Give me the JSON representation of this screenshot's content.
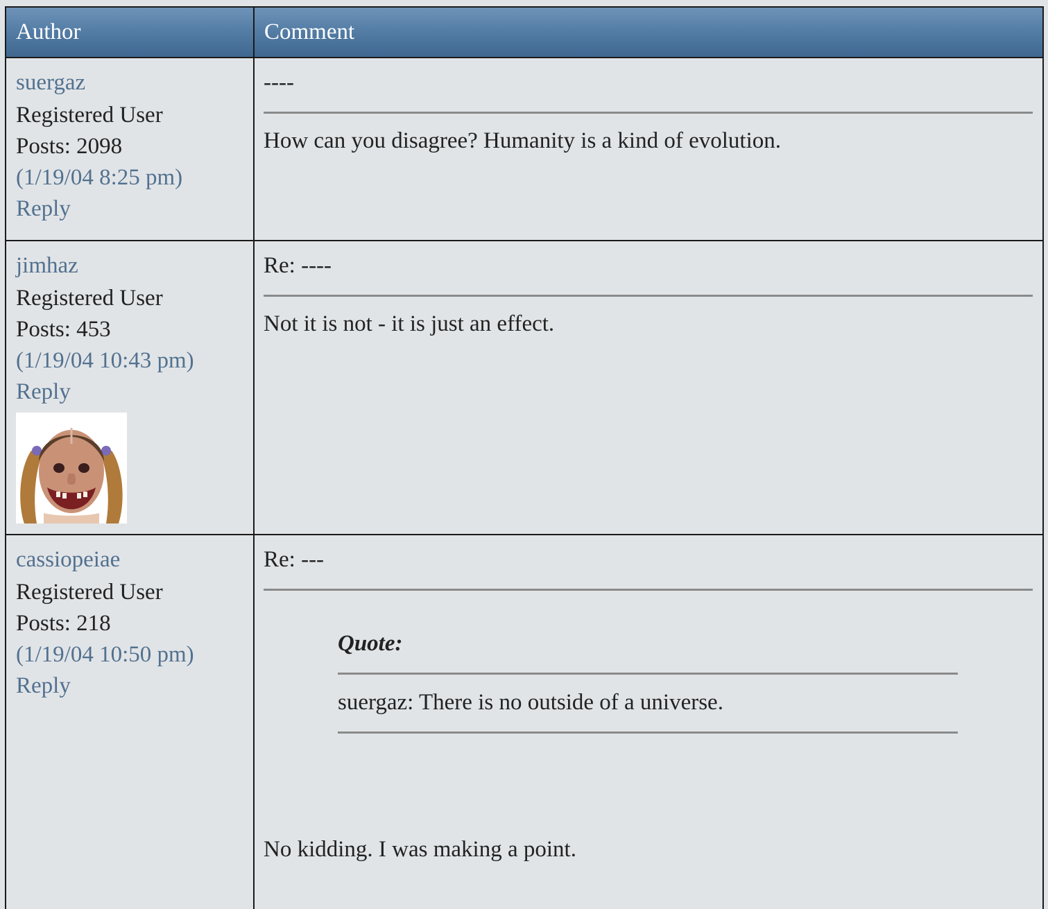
{
  "header": {
    "author_label": "Author",
    "comment_label": "Comment"
  },
  "posts": [
    {
      "author": "suergaz",
      "title": "Registered User",
      "posts": "Posts: 2098",
      "date": "(1/19/04 8:25 pm)",
      "reply": "Reply",
      "subject": "----",
      "body": "How can you disagree? Humanity is a kind of evolution."
    },
    {
      "author": "jimhaz",
      "title": "Registered User",
      "posts": "Posts: 453",
      "date": "(1/19/04 10:43 pm)",
      "reply": "Reply",
      "subject": "Re: ----",
      "body": "Not it is not - it is just an effect.",
      "avatar_icon": "user-avatar-face-icon"
    },
    {
      "author": "cassiopeiae",
      "title": "Registered User",
      "posts": "Posts: 218",
      "date": "(1/19/04 10:50 pm)",
      "reply": "Reply",
      "subject": "Re: ---",
      "quote_label": "Quote:",
      "quote_text": "suergaz: There is no outside of a universe.",
      "body": "No kidding. I was making a point."
    }
  ],
  "colors": {
    "link": "#52718f",
    "header_bg": "#557ea6",
    "page_bg": "#e1e4e7"
  }
}
